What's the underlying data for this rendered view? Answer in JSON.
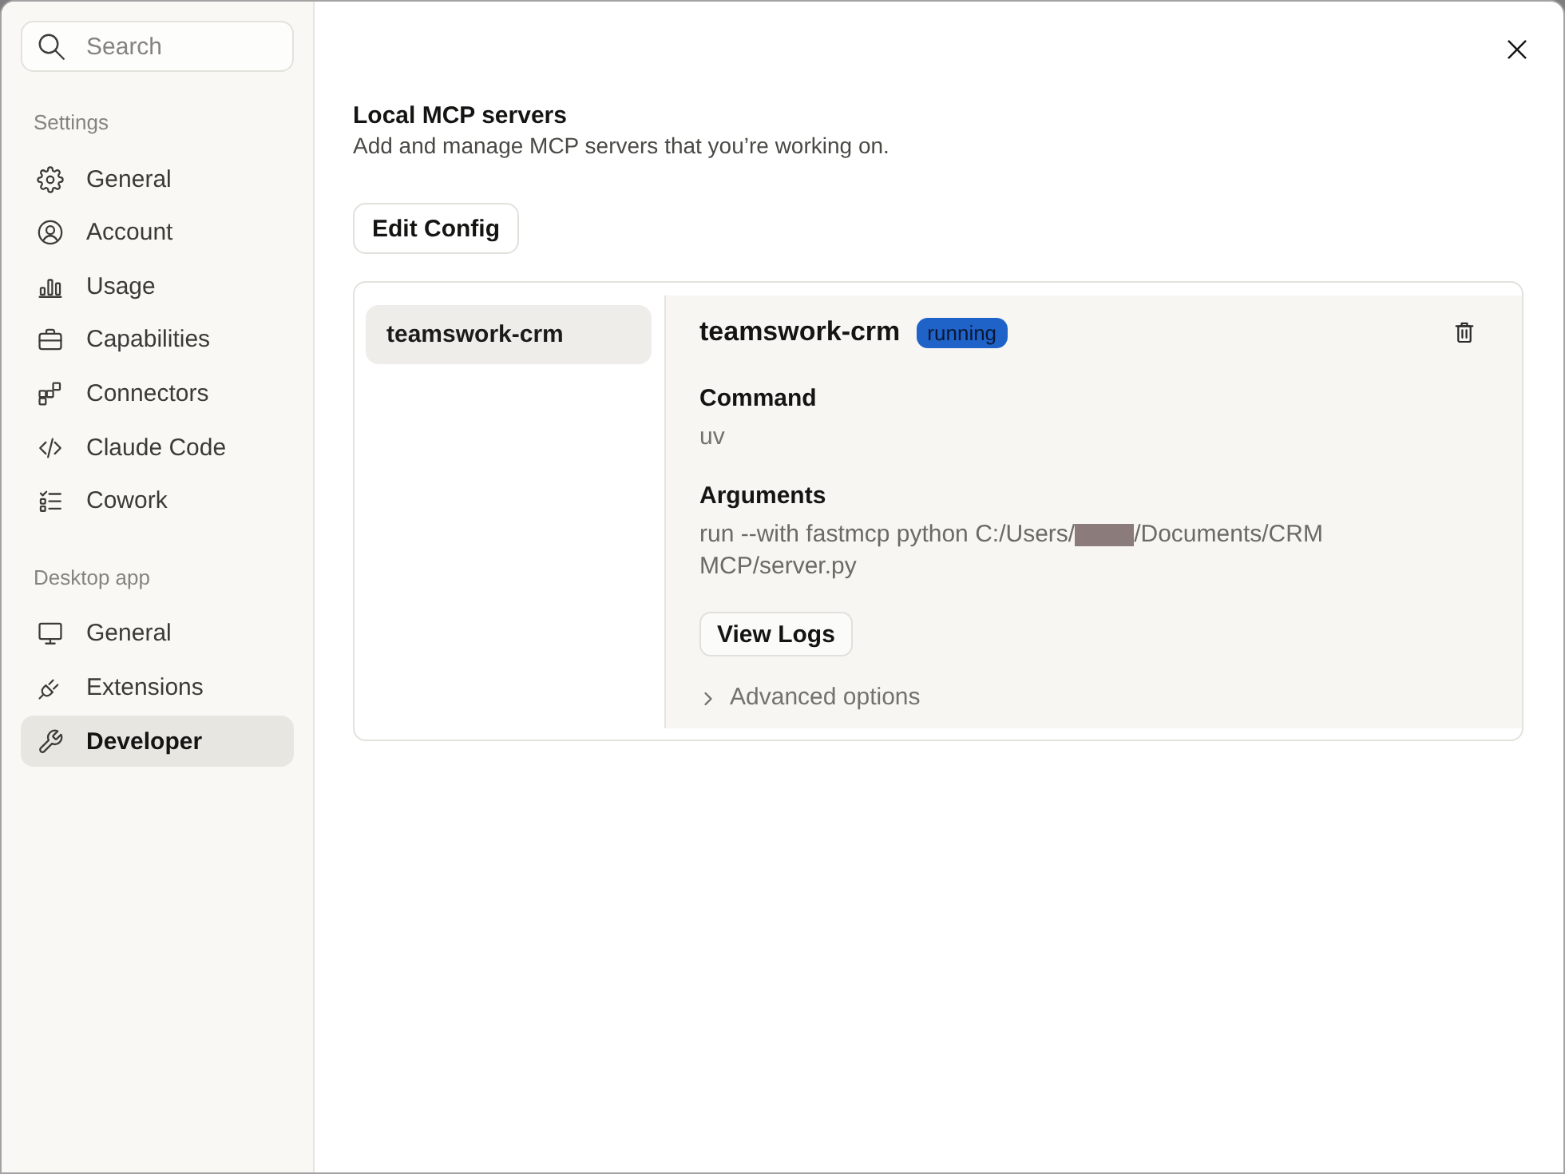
{
  "sidebar": {
    "search": {
      "placeholder": "Search"
    },
    "sections": [
      {
        "title": "Settings",
        "items": [
          {
            "label": "General",
            "selected": false
          },
          {
            "label": "Account",
            "selected": false
          },
          {
            "label": "Usage",
            "selected": false
          },
          {
            "label": "Capabilities",
            "selected": false
          },
          {
            "label": "Connectors",
            "selected": false
          },
          {
            "label": "Claude Code",
            "selected": false
          },
          {
            "label": "Cowork",
            "selected": false
          }
        ]
      },
      {
        "title": "Desktop app",
        "items": [
          {
            "label": "General",
            "selected": false
          },
          {
            "label": "Extensions",
            "selected": false
          },
          {
            "label": "Developer",
            "selected": true
          }
        ]
      }
    ]
  },
  "page": {
    "title": "Local MCP servers",
    "subtitle": "Add and manage MCP servers that you’re working on.",
    "edit_button": "Edit Config"
  },
  "servers": [
    {
      "name": "teamswork-crm",
      "selected": true
    }
  ],
  "detail": {
    "name": "teamswork-crm",
    "status": "running",
    "command": {
      "label": "Command",
      "value": "uv"
    },
    "arguments": {
      "label": "Arguments",
      "lines": [
        [
          {
            "kind": "text",
            "text": "run --with fastmcp python C:/Users/"
          },
          {
            "kind": "redacted"
          },
          {
            "kind": "text",
            "text": "/Documents/CRM"
          }
        ],
        [
          {
            "kind": "text",
            "text": "MCP/server.py"
          }
        ]
      ]
    },
    "view_logs": "View Logs",
    "advanced": {
      "label": "Advanced options",
      "expanded": false
    }
  }
}
